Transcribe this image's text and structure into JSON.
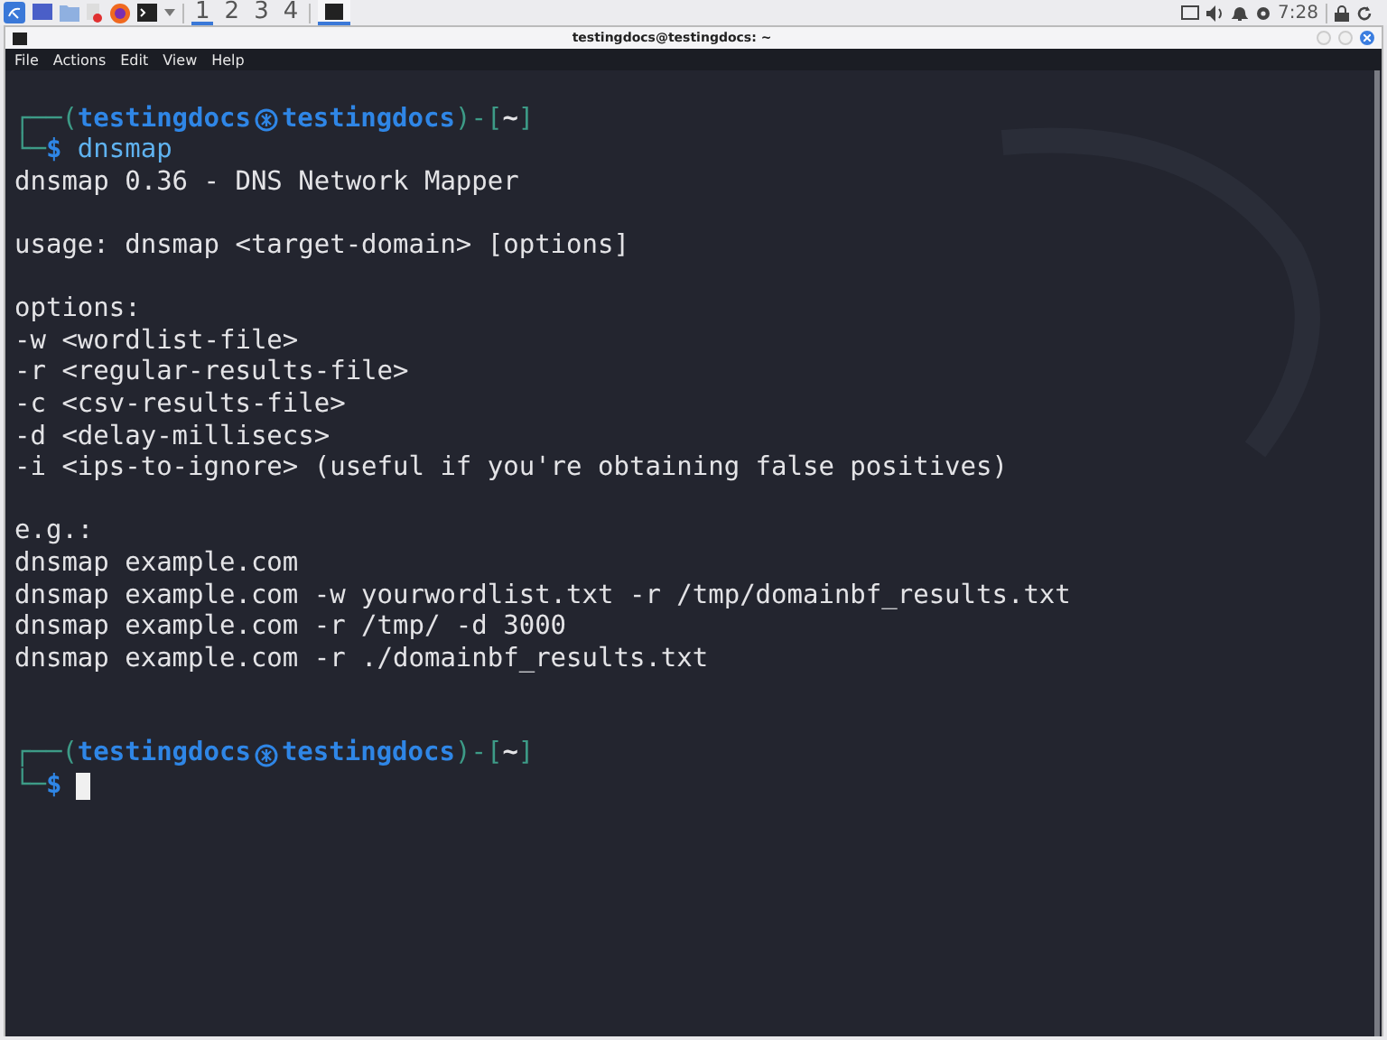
{
  "panel": {
    "workspaces": [
      {
        "label": "1",
        "selected": true
      },
      {
        "label": "2",
        "selected": false
      },
      {
        "label": "3",
        "selected": false
      },
      {
        "label": "4",
        "selected": false
      }
    ],
    "task": {
      "selected": true
    },
    "clock": "7:28"
  },
  "window": {
    "title": "testingdocs@testingdocs: ~"
  },
  "menu": [
    "File",
    "Actions",
    "Edit",
    "View",
    "Help"
  ],
  "terminal": {
    "lines": [
      {
        "kind": "blank"
      },
      {
        "kind": "text",
        "spans": [
          {
            "kind": "frame",
            "text": "┌──("
          },
          {
            "kind": "user",
            "text": "testingdocs"
          },
          {
            "kind": "at-symbol"
          },
          {
            "kind": "user",
            "text": "testingdocs"
          },
          {
            "kind": "frame",
            "text": ")-["
          },
          {
            "kind": "dir",
            "text": "~"
          },
          {
            "kind": "frame",
            "text": "]"
          }
        ]
      },
      {
        "kind": "text",
        "spans": [
          {
            "kind": "frame",
            "text": "└─"
          },
          {
            "kind": "user",
            "text": "$"
          },
          {
            "kind": "command",
            "text": " dnsmap"
          }
        ]
      },
      {
        "kind": "text",
        "spans": [
          {
            "kind": "output",
            "text": "dnsmap 0.36 - DNS Network Mapper"
          }
        ]
      },
      {
        "kind": "blank"
      },
      {
        "kind": "text",
        "spans": [
          {
            "kind": "output",
            "text": "usage: dnsmap <target-domain> [options]"
          }
        ]
      },
      {
        "kind": "blank"
      },
      {
        "kind": "text",
        "spans": [
          {
            "kind": "output",
            "text": "options:"
          }
        ]
      },
      {
        "kind": "text",
        "spans": [
          {
            "kind": "output",
            "text": "-w <wordlist-file>"
          }
        ]
      },
      {
        "kind": "text",
        "spans": [
          {
            "kind": "output",
            "text": "-r <regular-results-file>"
          }
        ]
      },
      {
        "kind": "text",
        "spans": [
          {
            "kind": "output",
            "text": "-c <csv-results-file>"
          }
        ]
      },
      {
        "kind": "text",
        "spans": [
          {
            "kind": "output",
            "text": "-d <delay-millisecs>"
          }
        ]
      },
      {
        "kind": "text",
        "spans": [
          {
            "kind": "output",
            "text": "-i <ips-to-ignore> (useful if you're obtaining false positives)"
          }
        ]
      },
      {
        "kind": "blank"
      },
      {
        "kind": "text",
        "spans": [
          {
            "kind": "output",
            "text": "e.g.:"
          }
        ]
      },
      {
        "kind": "text",
        "spans": [
          {
            "kind": "output",
            "text": "dnsmap example.com"
          }
        ]
      },
      {
        "kind": "text",
        "spans": [
          {
            "kind": "output",
            "text": "dnsmap example.com -w yourwordlist.txt -r /tmp/domainbf_results.txt"
          }
        ]
      },
      {
        "kind": "text",
        "spans": [
          {
            "kind": "output",
            "text": "dnsmap example.com -r /tmp/ -d 3000"
          }
        ]
      },
      {
        "kind": "text",
        "spans": [
          {
            "kind": "output",
            "text": "dnsmap example.com -r ./domainbf_results.txt"
          }
        ]
      },
      {
        "kind": "blank"
      },
      {
        "kind": "blank"
      },
      {
        "kind": "text",
        "spans": [
          {
            "kind": "frame",
            "text": "┌──("
          },
          {
            "kind": "user",
            "text": "testingdocs"
          },
          {
            "kind": "at-symbol"
          },
          {
            "kind": "user",
            "text": "testingdocs"
          },
          {
            "kind": "frame",
            "text": ")-["
          },
          {
            "kind": "dir",
            "text": "~"
          },
          {
            "kind": "frame",
            "text": "]"
          }
        ]
      },
      {
        "kind": "text",
        "spans": [
          {
            "kind": "frame",
            "text": "└─"
          },
          {
            "kind": "user",
            "text": "$"
          },
          {
            "kind": "cursor"
          }
        ]
      }
    ]
  }
}
